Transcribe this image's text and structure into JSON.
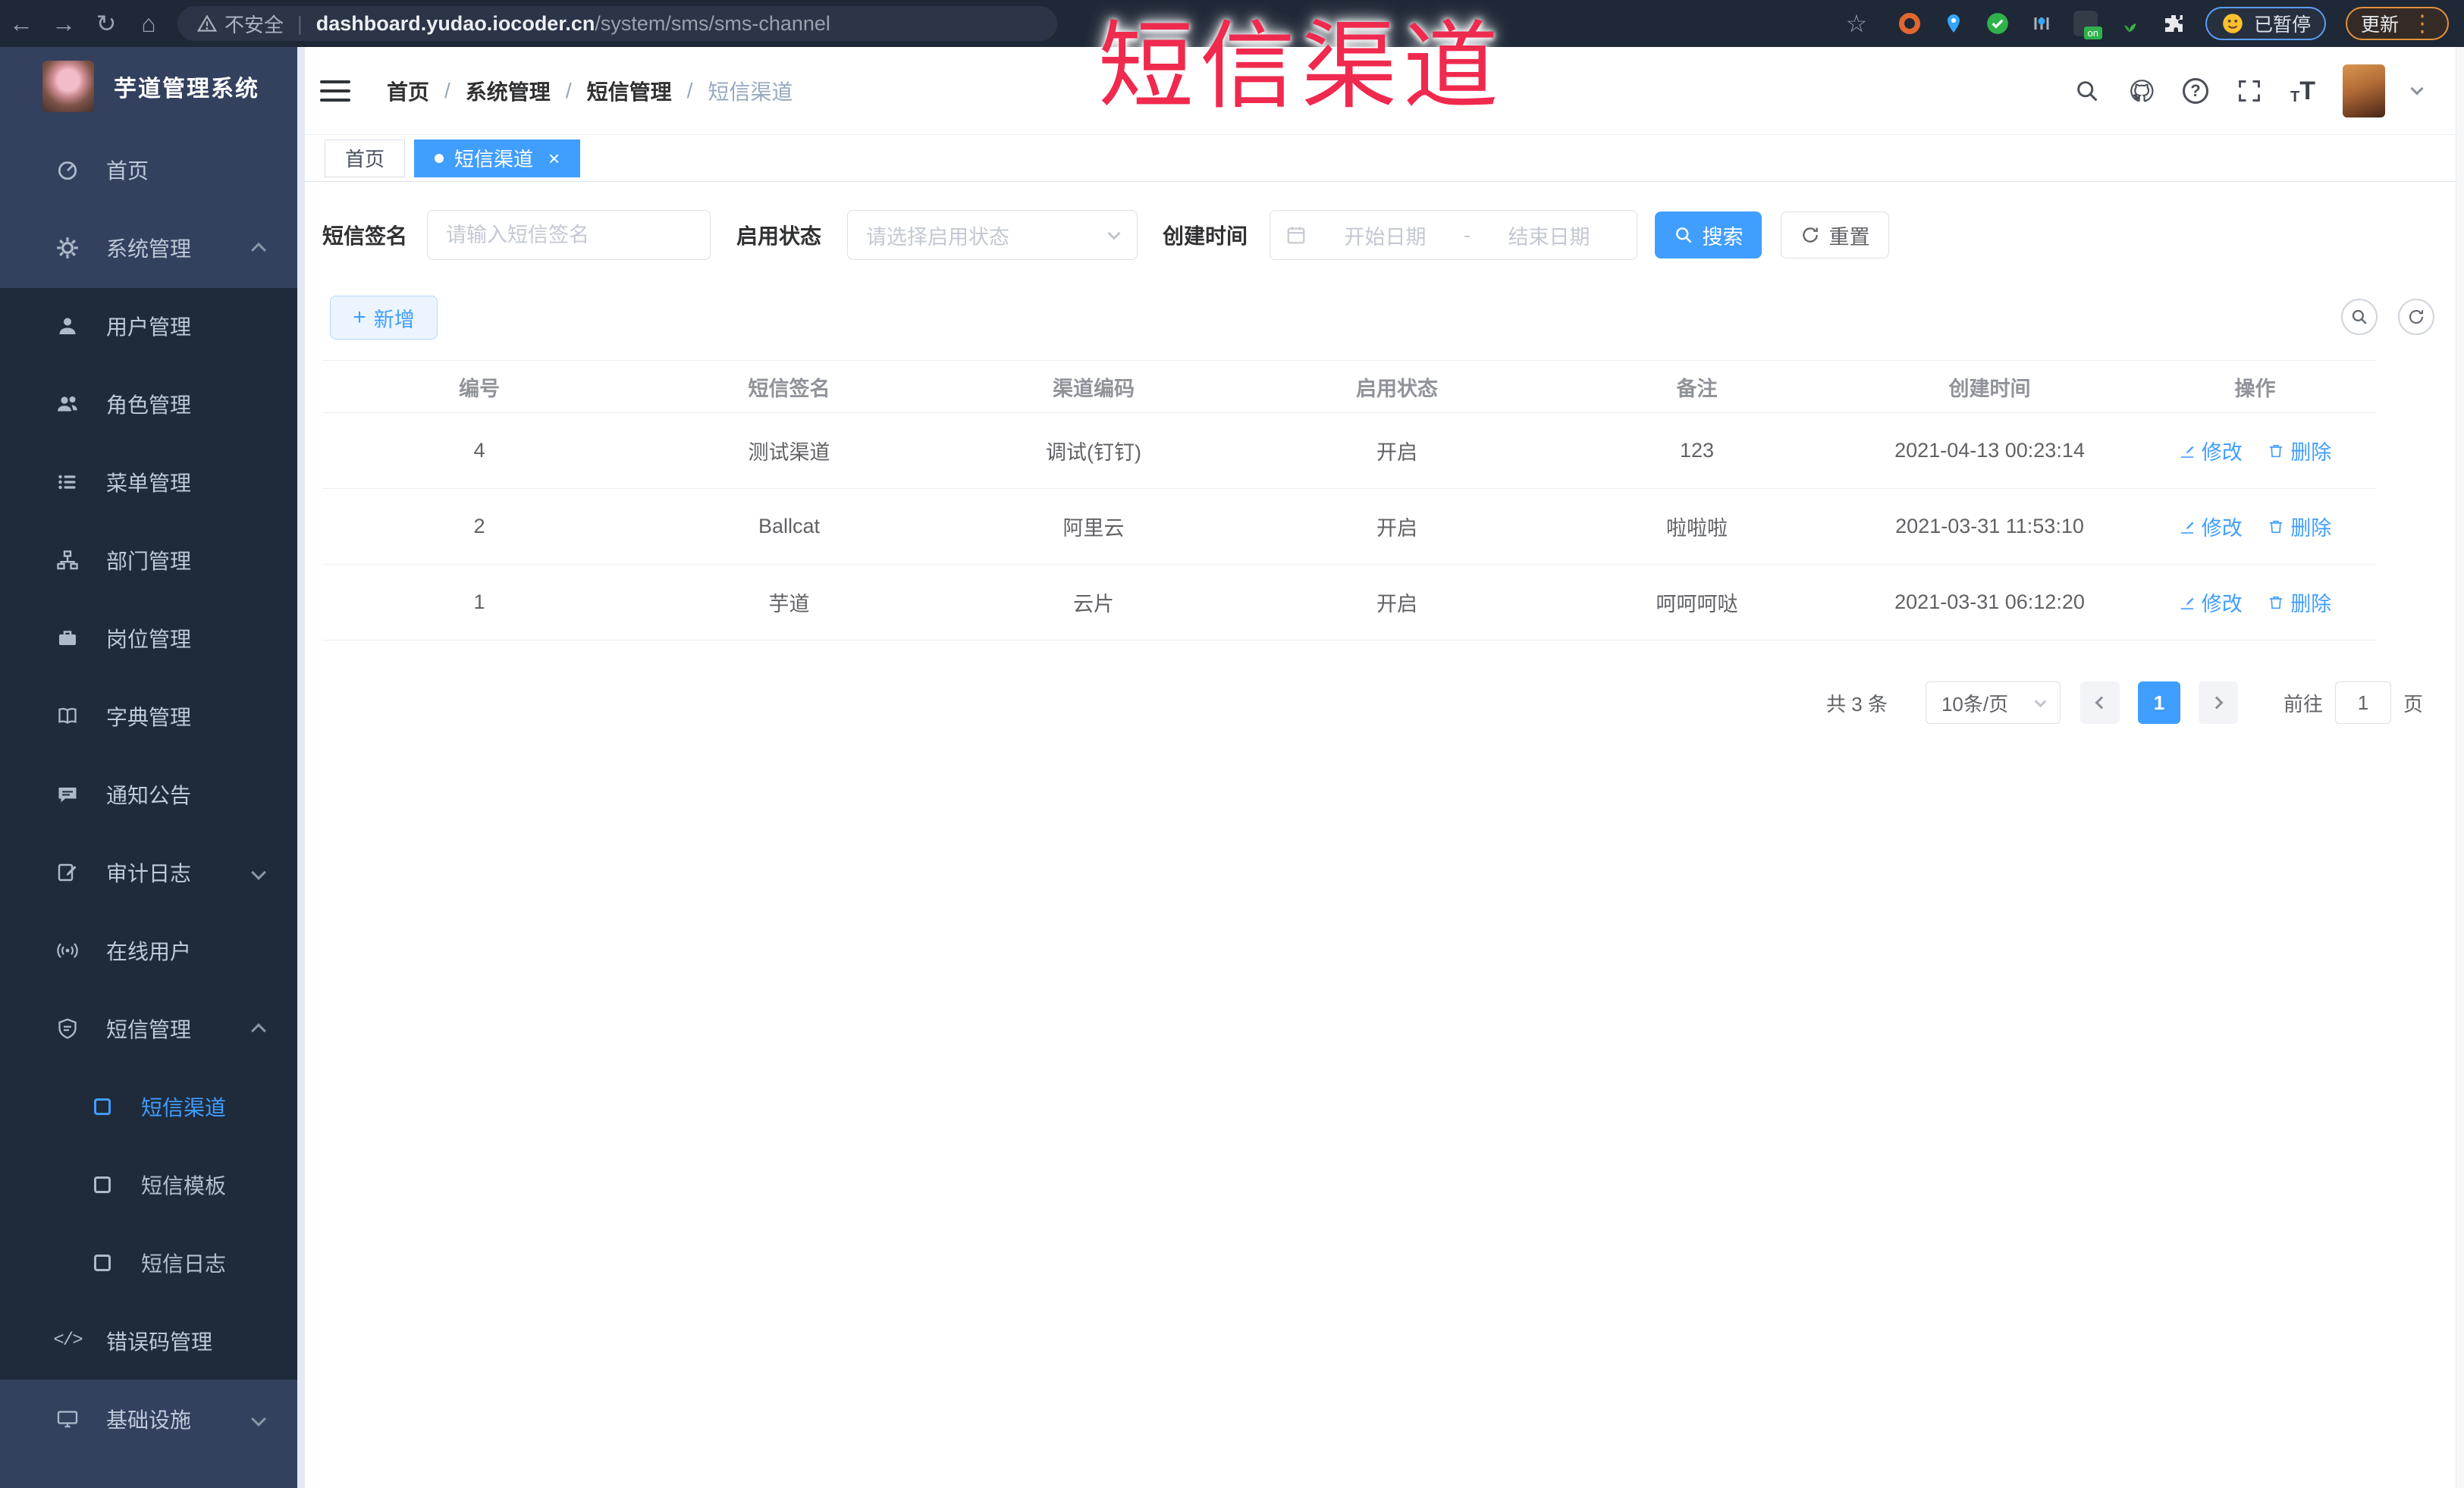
{
  "colors": {
    "accent": "#409eff",
    "overlay_red": "#f0294e",
    "sidebar_dark": "#1f2a3a",
    "sidebar_light": "#33405e"
  },
  "browser": {
    "security_warning": "不安全",
    "url_domain": "dashboard.yudao.iocoder.cn",
    "url_path": "/system/sms/sms-channel",
    "ext_on_badge": "on",
    "paused_badge": "已暂停",
    "update_button": "更新"
  },
  "overlay_title": "短信渠道",
  "sidebar": {
    "app_title": "芋道管理系统",
    "items": [
      {
        "label": "首页"
      },
      {
        "label": "系统管理"
      },
      {
        "label": "用户管理"
      },
      {
        "label": "角色管理"
      },
      {
        "label": "菜单管理"
      },
      {
        "label": "部门管理"
      },
      {
        "label": "岗位管理"
      },
      {
        "label": "字典管理"
      },
      {
        "label": "通知公告"
      },
      {
        "label": "审计日志"
      },
      {
        "label": "在线用户"
      },
      {
        "label": "短信管理"
      },
      {
        "label": "短信渠道"
      },
      {
        "label": "短信模板"
      },
      {
        "label": "短信日志"
      },
      {
        "label": "错误码管理"
      },
      {
        "label": "基础设施"
      }
    ]
  },
  "breadcrumb": {
    "sep": "/",
    "items": [
      "首页",
      "系统管理",
      "短信管理",
      "短信渠道"
    ]
  },
  "tabs": [
    {
      "label": "首页"
    },
    {
      "label": "短信渠道"
    }
  ],
  "filters": {
    "sign_label": "短信签名",
    "sign_placeholder": "请输入短信签名",
    "status_label": "启用状态",
    "status_placeholder": "请选择启用状态",
    "time_label": "创建时间",
    "date_start_placeholder": "开始日期",
    "date_separator": "-",
    "date_end_placeholder": "结束日期",
    "search_button": "搜索",
    "reset_button": "重置"
  },
  "toolbar": {
    "add_button": "新增"
  },
  "table": {
    "headers": [
      "编号",
      "短信签名",
      "渠道编码",
      "启用状态",
      "备注",
      "创建时间",
      "操作"
    ],
    "edit_label": "修改",
    "delete_label": "删除",
    "rows": [
      {
        "id": "4",
        "sign": "测试渠道",
        "code": "调试(钉钉)",
        "status": "开启",
        "remark": "123",
        "created": "2021-04-13 00:23:14"
      },
      {
        "id": "2",
        "sign": "Ballcat",
        "code": "阿里云",
        "status": "开启",
        "remark": "啦啦啦",
        "created": "2021-03-31 11:53:10"
      },
      {
        "id": "1",
        "sign": "芋道",
        "code": "云片",
        "status": "开启",
        "remark": "呵呵呵哒",
        "created": "2021-03-31 06:12:20"
      }
    ]
  },
  "pagination": {
    "total": "共 3 条",
    "page_size": "10条/页",
    "current_page": "1",
    "goto_label": "前往",
    "goto_value": "1",
    "page_unit": "页"
  }
}
